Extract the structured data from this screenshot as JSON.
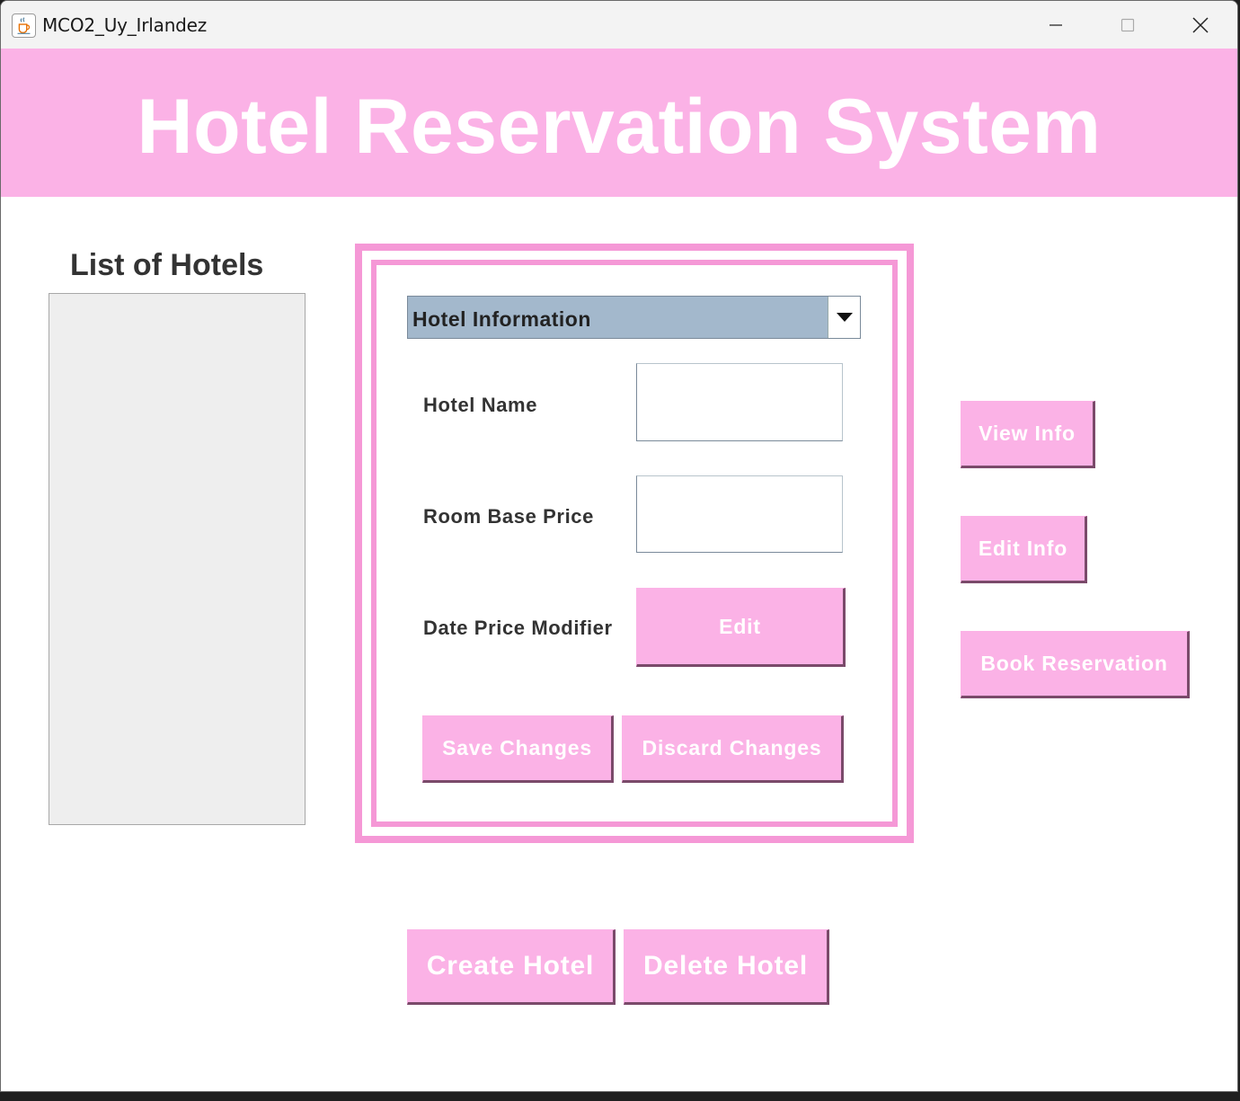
{
  "window": {
    "title": "MCO2_Uy_Irlandez",
    "app_icon": "java-cup-icon",
    "controls": [
      "minimize-icon",
      "maximize-icon",
      "close-icon"
    ]
  },
  "header": {
    "title": "Hotel Reservation System",
    "background": "#fbb2e6"
  },
  "hotel_list": {
    "heading": "List of Hotels",
    "items": []
  },
  "info_panel": {
    "combo_selected": "Hotel Information",
    "fields": {
      "hotel_name_label": "Hotel Name",
      "hotel_name_value": "",
      "room_base_price_label": "Room Base Price",
      "room_base_price_value": "",
      "date_price_modifier_label": "Date Price Modifier"
    },
    "edit_button": "Edit",
    "save_button": "Save Changes",
    "discard_button": "Discard Changes"
  },
  "side_actions": {
    "view_info": "View Info",
    "edit_info": "Edit Info",
    "book_reservation": "Book Reservation"
  },
  "bottom_actions": {
    "create_hotel": "Create Hotel",
    "delete_hotel": "Delete Hotel"
  },
  "colors": {
    "accent_pink": "#fbb2e6",
    "border_pink": "#f598d6",
    "combo_bg": "#a3b8cc"
  }
}
